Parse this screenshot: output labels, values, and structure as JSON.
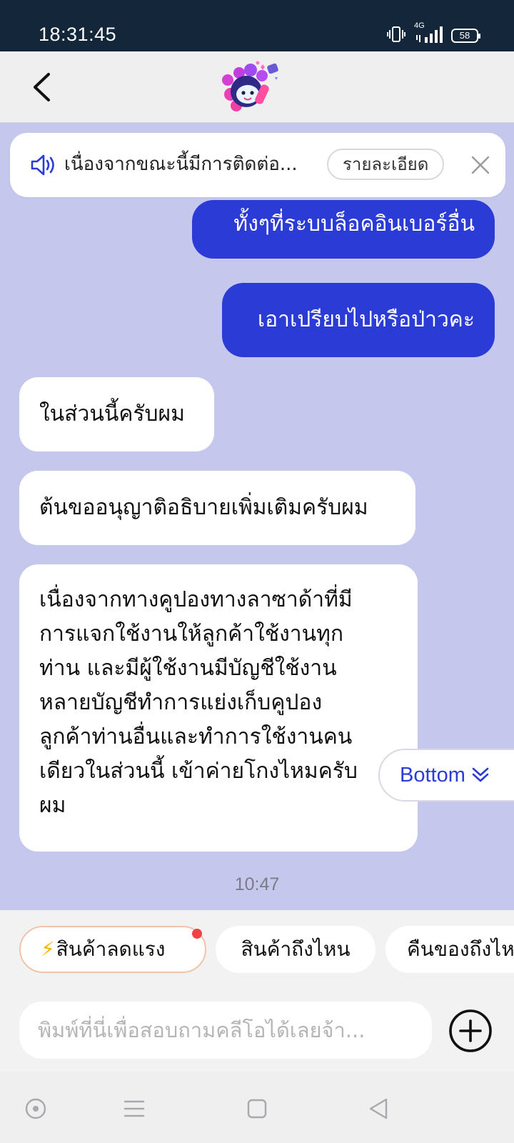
{
  "status_bar": {
    "time": "18:31:45",
    "network": "4G",
    "battery": "58",
    "icons": [
      "vibrate-icon",
      "signal-icon",
      "battery-icon"
    ]
  },
  "header": {
    "back_icon": "chevron-left-icon",
    "mascot": "mascot-logo"
  },
  "notice": {
    "icon": "speaker-icon",
    "text": "เนื่องจากขณะนี้มีการติดต่อ...",
    "detail_label": "รายละเอียด",
    "close_icon": "close-icon"
  },
  "messages": [
    {
      "sender": "user",
      "text": "ทั้งๆที่ระบบล็อคอินเบอร์อื่น"
    },
    {
      "sender": "user",
      "text": "เอาเปรียบไปหรือป่าวคะ"
    },
    {
      "sender": "agent",
      "text": "ในส่วนนี้ครับผม"
    },
    {
      "sender": "agent",
      "text": "ต้นขออนุญาติอธิบายเพิ่มเติมครับผม"
    },
    {
      "sender": "agent",
      "lines": [
        "เนื่องจากทางคูปองทางลาซาด้าที่มี",
        "การแจกใช้งานให้ลูกค้าใช้งานทุก",
        "ท่าน และมีผู้ใช้งานมีบัญชีใช้งาน",
        "หลายบัญชีทำการแย่งเก็บคูปอง",
        "ลูกค้าท่านอื่นและทำการใช้งานคน",
        "เดียวในส่วนนี้ เข้าค่ายโกงไหมครับ",
        "ผม"
      ]
    }
  ],
  "scroll_bottom_label": "Bottom",
  "timestamp": "10:47",
  "quick_replies": [
    {
      "label": "สินค้าลดแรง",
      "icon": "⚡",
      "has_dot": true
    },
    {
      "label": "สินค้าถึงไหน"
    },
    {
      "label": "คืนของถึงไหน"
    }
  ],
  "input": {
    "placeholder": "พิมพ์ที่นี่เพื่อสอบถามคลีโอได้เลยจ้า...",
    "value": "",
    "add_icon": "plus-circle-icon"
  },
  "nav_bar": {
    "icons": [
      "assistant-icon",
      "menu-icon",
      "home-icon",
      "back-icon"
    ]
  },
  "colors": {
    "chat_bg": "#c5c8ec",
    "user_bubble": "#2b3bd6",
    "agent_bubble": "#ffffff",
    "status_bar": "#13263a",
    "notification_dot": "#f24144"
  }
}
